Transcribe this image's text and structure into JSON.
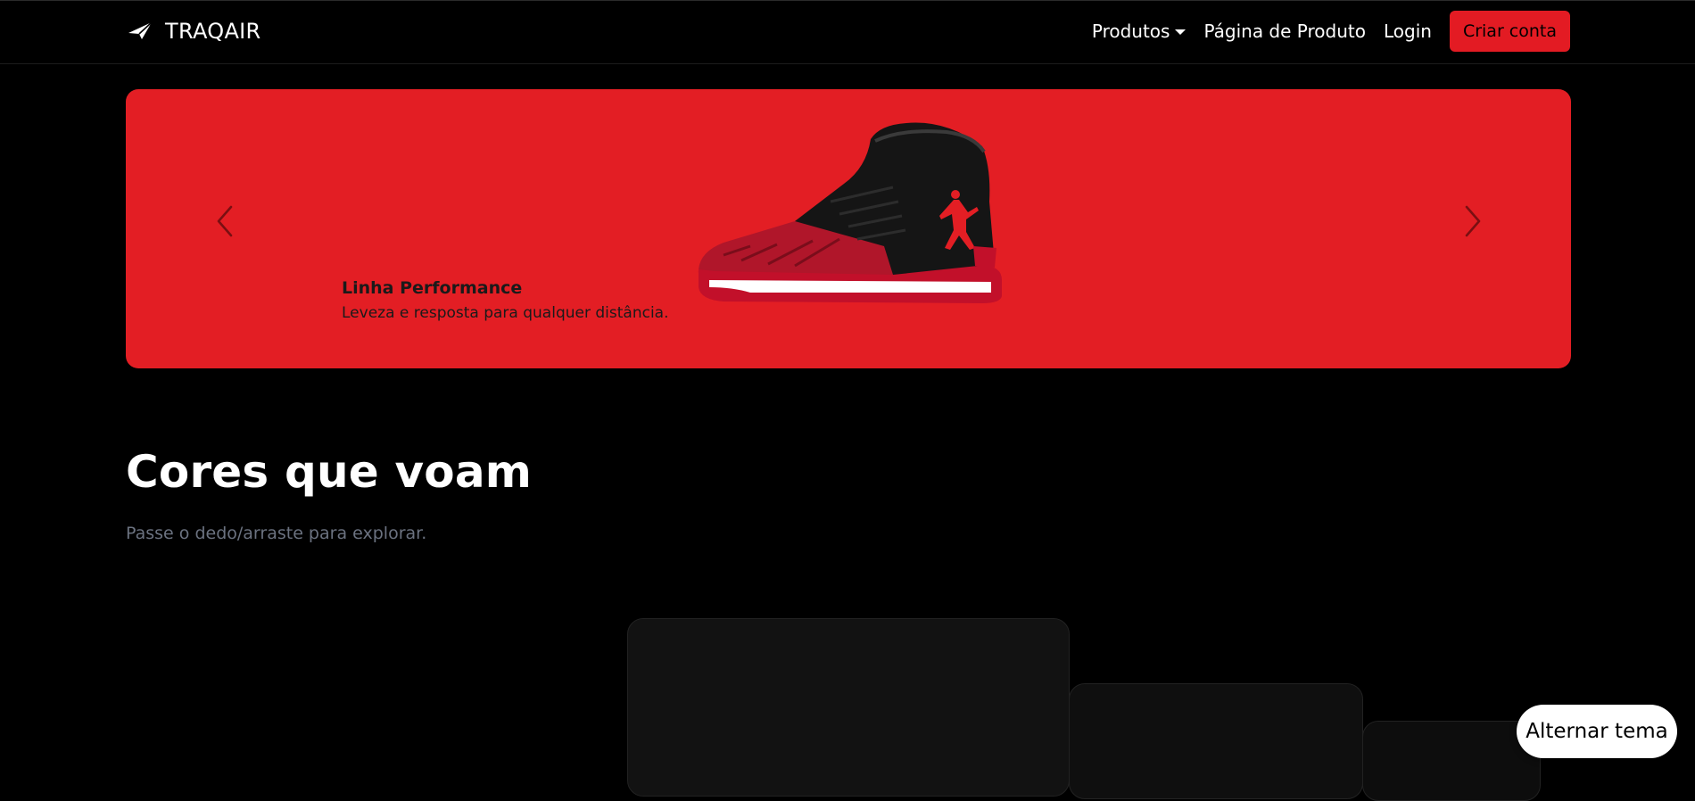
{
  "brand": {
    "name": "TRAQAIR",
    "icon": "paper-plane-icon"
  },
  "nav": {
    "products_label": "Produtos",
    "product_page_label": "Página de Produto",
    "login_label": "Login",
    "signup_label": "Criar conta"
  },
  "hero": {
    "slide_title": "Linha Performance",
    "slide_text": "Leveza e resposta para qualquer distância.",
    "prev_icon": "chevron-left-icon",
    "next_icon": "chevron-right-icon",
    "colors": {
      "background": "#e31e24"
    }
  },
  "section": {
    "title": "Cores que voam",
    "subtitle": "Passe o dedo/arraste para explorar."
  },
  "theme_toggle": {
    "label": "Alternar tema"
  },
  "colors": {
    "accent": "#e31b23",
    "background": "#000000",
    "muted_text": "#6b7280"
  }
}
